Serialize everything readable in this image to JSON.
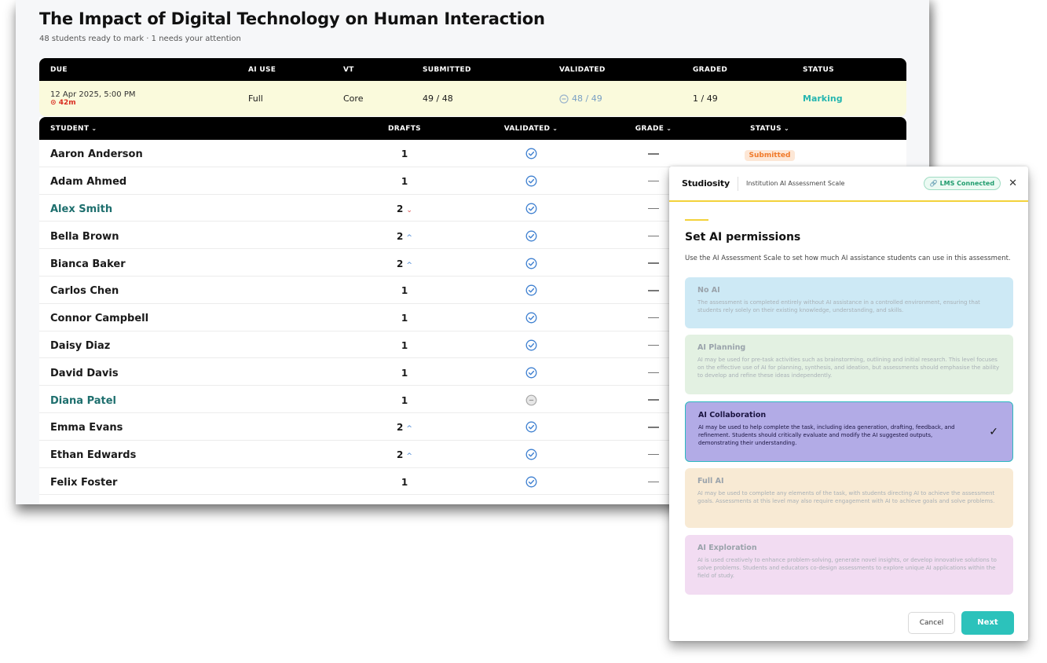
{
  "page": {
    "title": "The Impact of Digital Technology on Human Interaction",
    "subtitle": "48 students ready to mark · 1 needs your attention"
  },
  "summary": {
    "headers": [
      "DUE",
      "AI USE",
      "VT",
      "SUBMITTED",
      "VALIDATED",
      "GRADED",
      "STATUS"
    ],
    "due_date": "12 Apr 2025, 5:00 PM",
    "due_timer": "42m",
    "ai_use": "Full",
    "vt": "Core",
    "submitted": "49 / 48",
    "validated": "48 / 49",
    "graded": "1 / 49",
    "status": "Marking"
  },
  "students_table": {
    "headers": [
      "STUDENT",
      "DRAFTS",
      "VALIDATED",
      "GRADE",
      "STATUS"
    ],
    "rows": [
      {
        "name": "Aaron Anderson",
        "drafts": "1",
        "arrow": "",
        "validated": "check",
        "status": "Submitted",
        "link": false
      },
      {
        "name": "Adam Ahmed",
        "drafts": "1",
        "arrow": "",
        "validated": "check",
        "status": "",
        "link": false
      },
      {
        "name": "Alex Smith",
        "drafts": "2",
        "arrow": "down",
        "validated": "check",
        "status": "",
        "link": true
      },
      {
        "name": "Bella Brown",
        "drafts": "2",
        "arrow": "up",
        "validated": "check",
        "status": "",
        "link": false
      },
      {
        "name": "Bianca Baker",
        "drafts": "2",
        "arrow": "up",
        "validated": "check",
        "status": "",
        "link": false
      },
      {
        "name": "Carlos Chen",
        "drafts": "1",
        "arrow": "",
        "validated": "check",
        "status": "",
        "link": false
      },
      {
        "name": "Connor Campbell",
        "drafts": "1",
        "arrow": "",
        "validated": "check",
        "status": "",
        "link": false
      },
      {
        "name": "Daisy Diaz",
        "drafts": "1",
        "arrow": "",
        "validated": "check",
        "status": "",
        "link": false
      },
      {
        "name": "David Davis",
        "drafts": "1",
        "arrow": "",
        "validated": "check",
        "status": "",
        "link": false
      },
      {
        "name": "Diana Patel",
        "drafts": "1",
        "arrow": "",
        "validated": "pending",
        "status": "",
        "link": true
      },
      {
        "name": "Emma Evans",
        "drafts": "2",
        "arrow": "up",
        "validated": "check",
        "status": "",
        "link": false
      },
      {
        "name": "Ethan Edwards",
        "drafts": "2",
        "arrow": "up",
        "validated": "check",
        "status": "",
        "link": false
      },
      {
        "name": "Felix Foster",
        "drafts": "1",
        "arrow": "",
        "validated": "check",
        "status": "",
        "link": false
      }
    ]
  },
  "modal": {
    "brand": "Studiosity",
    "scale_name": "Institution AI Assessment Scale",
    "lms_badge": "LMS Connected",
    "title": "Set AI permissions",
    "description": "Use the AI Assessment Scale to set how much AI assistance students can use in this assessment.",
    "options": [
      {
        "title": "No AI",
        "desc": "The assessment is completed entirely without AI assistance in a controlled environment, ensuring that students rely solely on their existing knowledge, understanding, and skills.",
        "color": "#cde9f5",
        "selected": false
      },
      {
        "title": "AI Planning",
        "desc": "AI may be used for pre-task activities such as brainstorming, outlining and initial research. This level focuses on the effective use of AI for planning, synthesis, and ideation, but assessments should emphasise the ability to develop and refine these ideas independently.",
        "color": "#e3f1e2",
        "selected": false
      },
      {
        "title": "AI Collaboration",
        "desc": "AI may be used to help complete the task, including idea generation, drafting, feedback, and refinement. Students should critically evaluate and modify the AI suggested outputs, demonstrating their understanding.",
        "color": "#b2abe6",
        "selected": true
      },
      {
        "title": "Full AI",
        "desc": "AI may be used to complete any elements of the task, with students directing AI to achieve the assessment goals. Assessments at this level may also require engagement with AI to achieve goals and solve problems.",
        "color": "#f8ead4",
        "selected": false
      },
      {
        "title": "AI Exploration",
        "desc": "AI is used creatively to enhance problem-solving, generate novel insights, or develop innovative solutions to solve problems. Students and educators co-design assessments to explore unique AI applications within the field of study.",
        "color": "#f2dcf2",
        "selected": false
      }
    ],
    "cancel_label": "Cancel",
    "next_label": "Next"
  },
  "colors": {
    "accent_teal": "#2cc2bb",
    "accent_yellow": "#f3d23a",
    "link_green": "#1e6f6e"
  }
}
